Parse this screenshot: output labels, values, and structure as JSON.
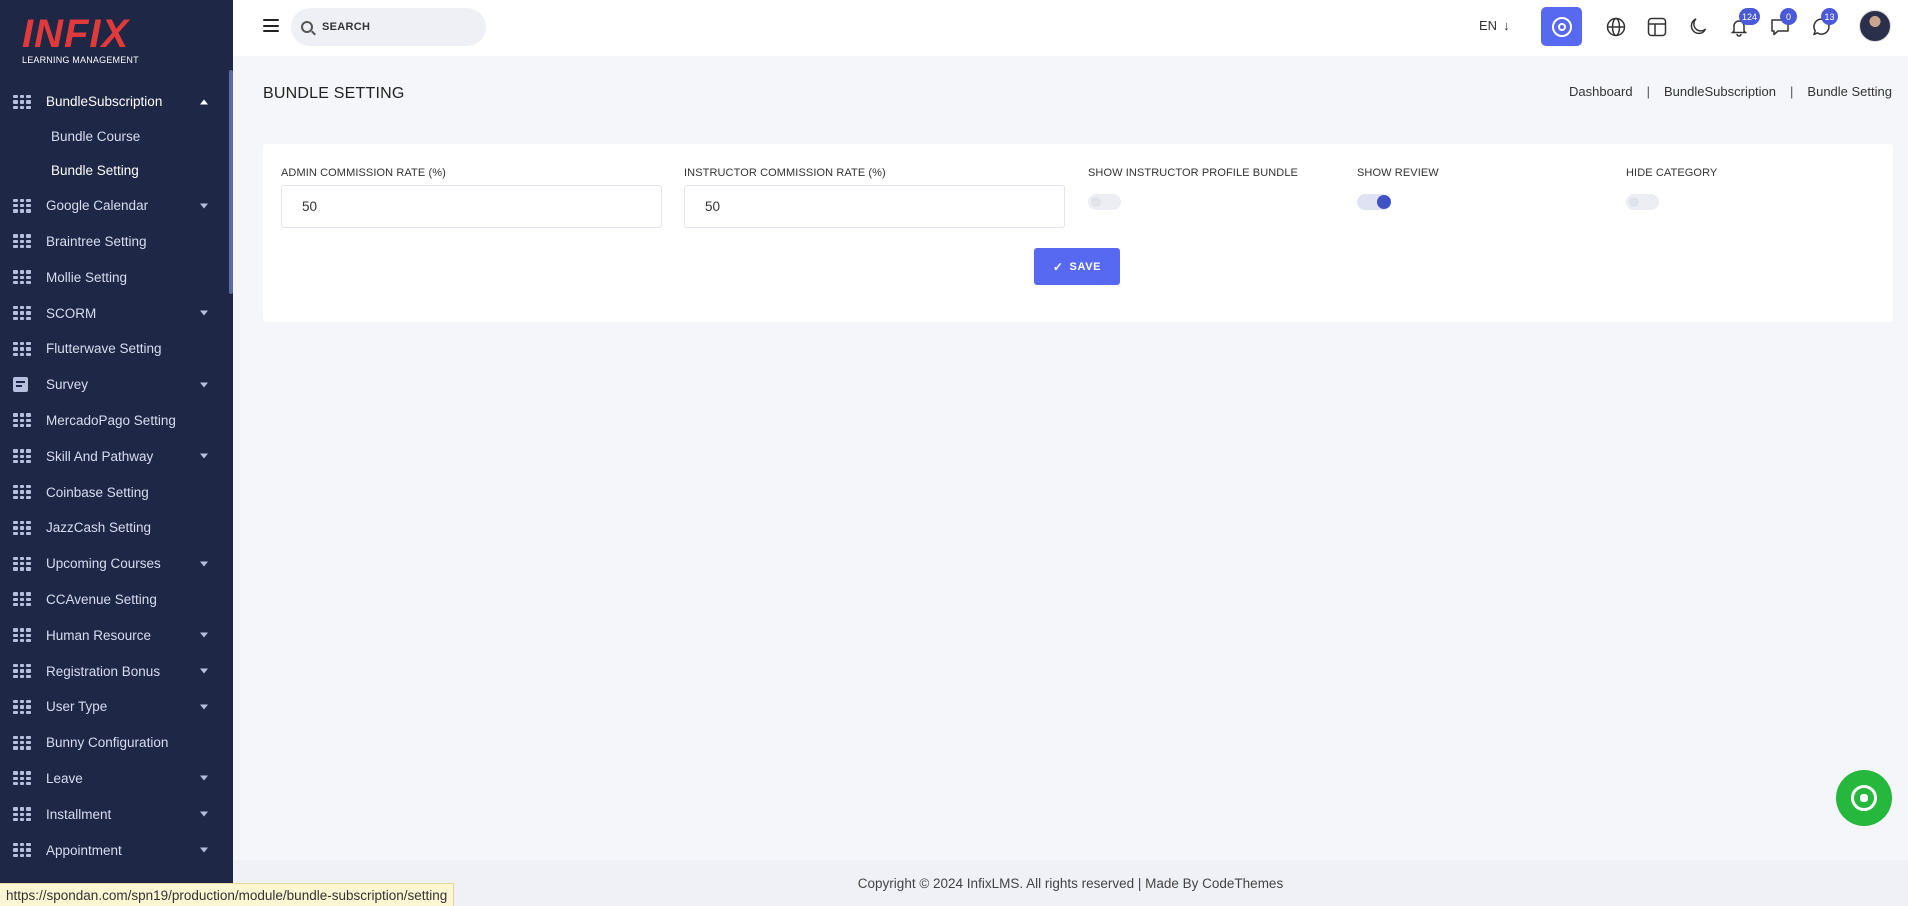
{
  "logo": {
    "main": "INFIX",
    "sub": "LEARNING MANAGEMENT"
  },
  "sidebar": {
    "items": [
      {
        "label": "BundleSubscription",
        "icon": "grid-icon",
        "expandable": true,
        "expanded": true,
        "children": [
          {
            "label": "Bundle Course"
          },
          {
            "label": "Bundle Setting"
          }
        ]
      },
      {
        "label": "Google Calendar",
        "icon": "grid-icon",
        "expandable": true
      },
      {
        "label": "Braintree Setting",
        "icon": "grid-icon",
        "expandable": false
      },
      {
        "label": "Mollie Setting",
        "icon": "grid-icon",
        "expandable": false
      },
      {
        "label": "SCORM",
        "icon": "grid-icon",
        "expandable": true
      },
      {
        "label": "Flutterwave Setting",
        "icon": "grid-icon",
        "expandable": false
      },
      {
        "label": "Survey",
        "icon": "document-icon",
        "expandable": true
      },
      {
        "label": "MercadoPago Setting",
        "icon": "grid-icon",
        "expandable": false
      },
      {
        "label": "Skill And Pathway",
        "icon": "grid-icon",
        "expandable": true
      },
      {
        "label": "Coinbase Setting",
        "icon": "grid-icon",
        "expandable": false
      },
      {
        "label": "JazzCash Setting",
        "icon": "grid-icon",
        "expandable": false
      },
      {
        "label": "Upcoming Courses",
        "icon": "grid-icon",
        "expandable": true
      },
      {
        "label": "CCAvenue Setting",
        "icon": "grid-icon",
        "expandable": false
      },
      {
        "label": "Human Resource",
        "icon": "grid-icon",
        "expandable": true
      },
      {
        "label": "Registration Bonus",
        "icon": "grid-icon",
        "expandable": true
      },
      {
        "label": "User Type",
        "icon": "grid-icon",
        "expandable": true
      },
      {
        "label": "Bunny Configuration",
        "icon": "grid-icon",
        "expandable": false
      },
      {
        "label": "Leave",
        "icon": "grid-icon",
        "expandable": true
      },
      {
        "label": "Installment",
        "icon": "grid-icon",
        "expandable": true
      },
      {
        "label": "Appointment",
        "icon": "grid-icon",
        "expandable": true
      }
    ]
  },
  "header": {
    "search_placeholder": "SEARCH",
    "language": "EN",
    "language_arrow": "↓",
    "notifications_count": "124",
    "messages_count": "0",
    "whatsapp_count": "13"
  },
  "page": {
    "title": "BUNDLE SETTING",
    "breadcrumb": [
      "Dashboard",
      "BundleSubscription",
      "Bundle Setting"
    ],
    "breadcrumb_separator": "|"
  },
  "form": {
    "admin_commission_label": "ADMIN COMMISSION RATE (%)",
    "admin_commission_value": "50",
    "instructor_commission_label": "INSTRUCTOR COMMISSION RATE (%)",
    "instructor_commission_value": "50",
    "show_instructor_profile_label": "SHOW INSTRUCTOR PROFILE BUNDLE",
    "show_instructor_profile_on": false,
    "show_review_label": "SHOW REVIEW",
    "show_review_on": true,
    "hide_category_label": "HIDE CATEGORY",
    "hide_category_on": false,
    "save_check": "✓",
    "save_label": "SAVE"
  },
  "footer": {
    "text": "Copyright © 2024 InfixLMS. All rights reserved | Made By CodeThemes"
  },
  "status_url": "https://spondan.com/spn19/production/module/bundle-subscription/setting",
  "colors": {
    "sidebar_bg": "#1e2745",
    "accent": "#5669f0",
    "whatsapp": "#25b83d"
  }
}
